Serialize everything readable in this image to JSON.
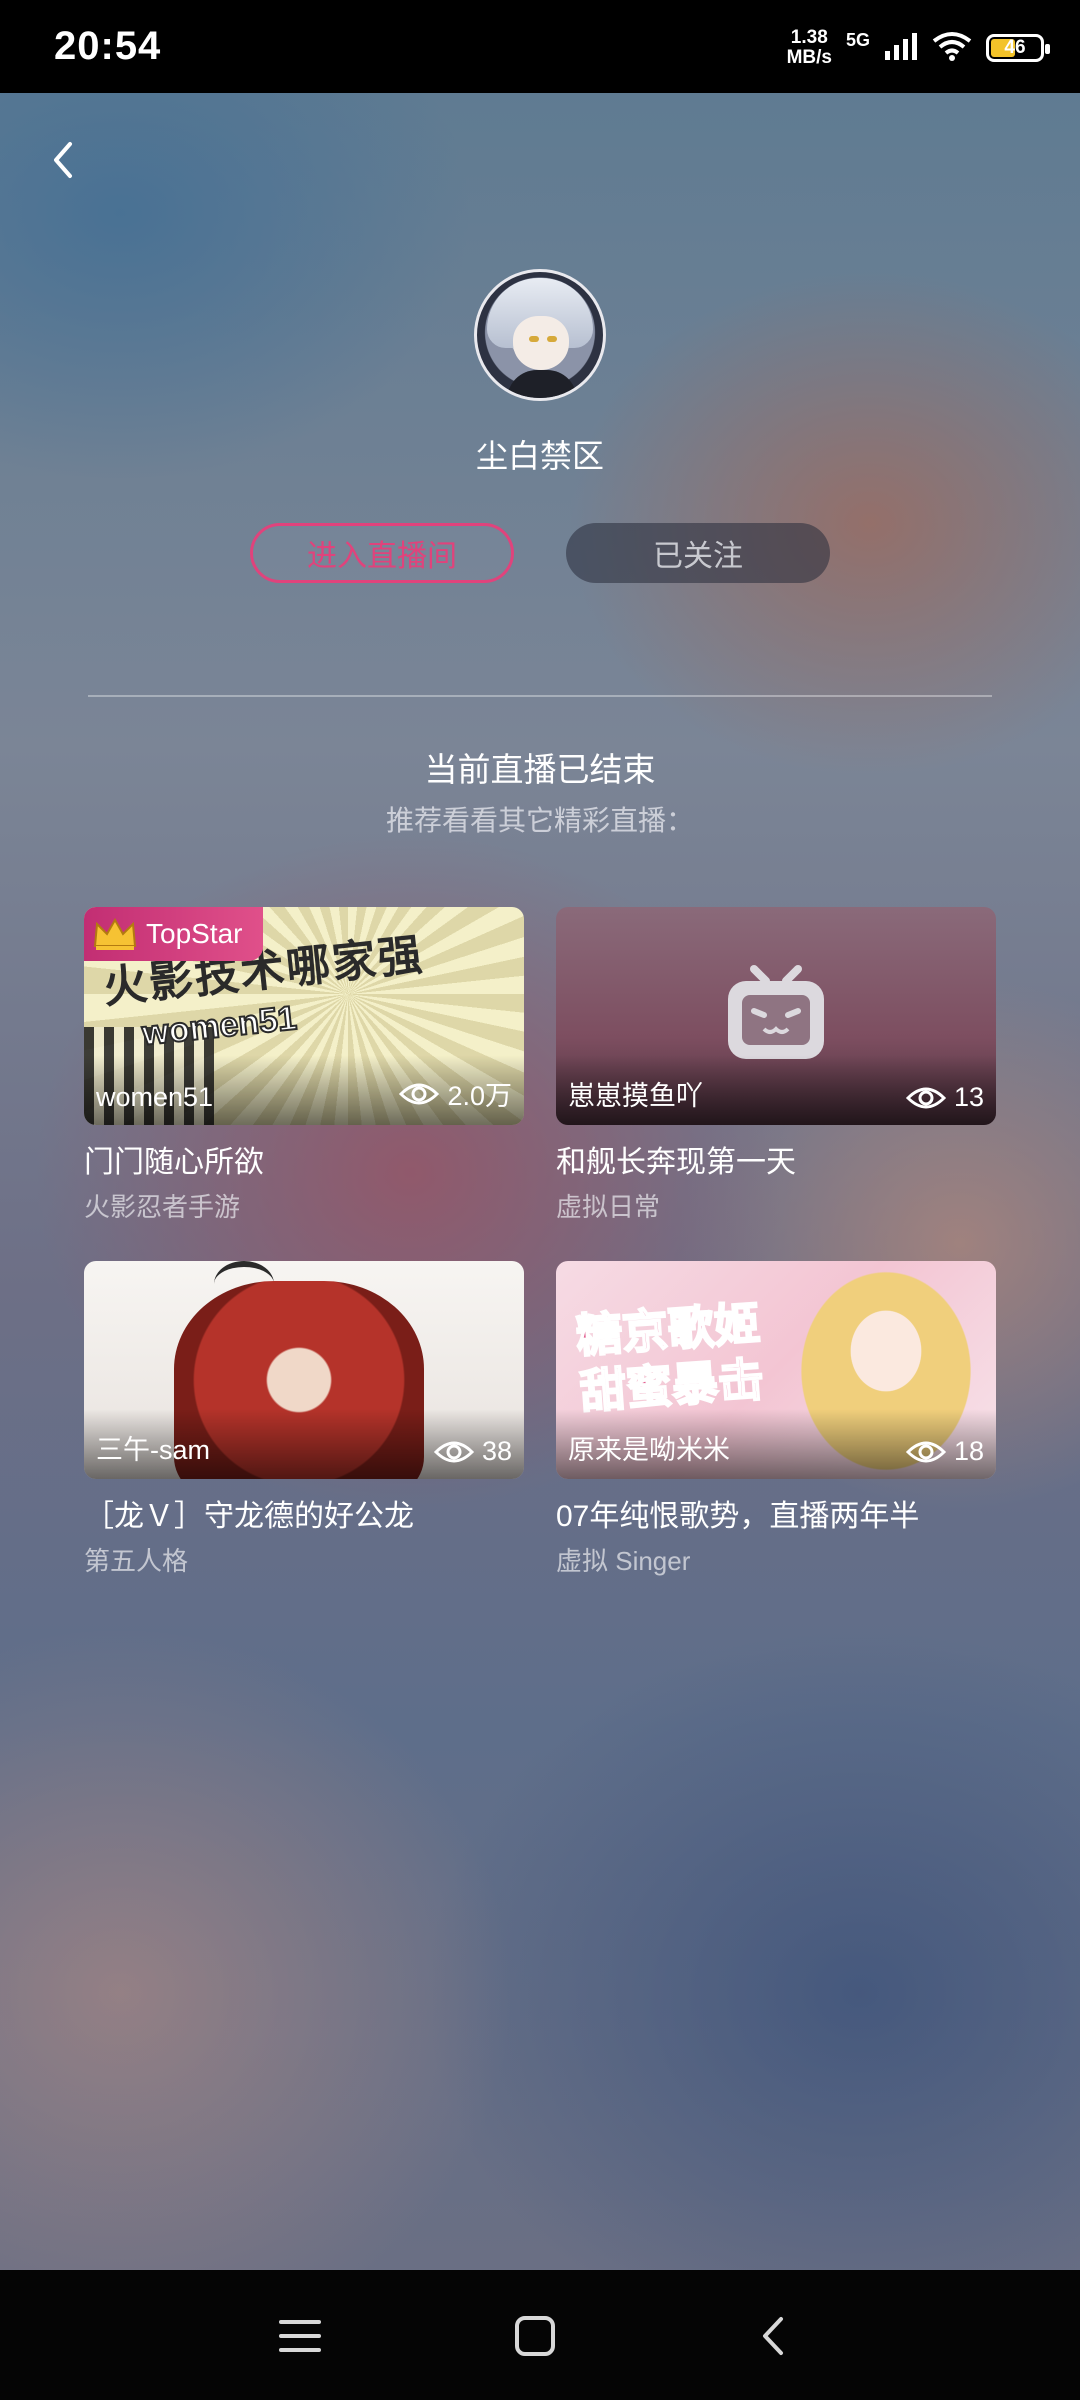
{
  "status_bar": {
    "time": "20:54",
    "net_speed_value": "1.38",
    "net_speed_unit": "MB/s",
    "network_type": "5G",
    "battery": "46"
  },
  "streamer": {
    "name": "尘白禁区",
    "enter_button": "进入直播间",
    "follow_button": "已关注"
  },
  "ended": {
    "title": "当前直播已结束",
    "subtitle": "推荐看看其它精彩直播："
  },
  "cards": [
    {
      "badge": "TopStar",
      "uploader": "women51",
      "views": "2.0万",
      "title": "门门随心所欲",
      "category": "火影忍者手游",
      "art_text": "火影技术哪家强",
      "art_text2": "women51"
    },
    {
      "uploader": "崽崽摸鱼吖",
      "views": "13",
      "title": "和舰长奔现第一天",
      "category": "虚拟日常"
    },
    {
      "uploader": "三午-sam",
      "views": "38",
      "title": "［龙Ｖ］守龙德的好公龙",
      "category": "第五人格"
    },
    {
      "uploader": "原来是呦米米",
      "views": "18",
      "title": "07年纯恨歌势，直播两年半",
      "category": "虚拟 Singer",
      "art_text": "糖京歌姬甜蜜暴击"
    }
  ],
  "colors": {
    "accent_pink": "#e0437c",
    "badge_pink": "#c22e73",
    "battery_yellow": "#f3c329"
  },
  "icons": {
    "back": "chevron-left-icon",
    "views": "eye-icon",
    "badge": "crown-icon",
    "nav_menu": "menu-icon",
    "nav_home": "square-icon",
    "nav_back": "chevron-left-icon"
  }
}
